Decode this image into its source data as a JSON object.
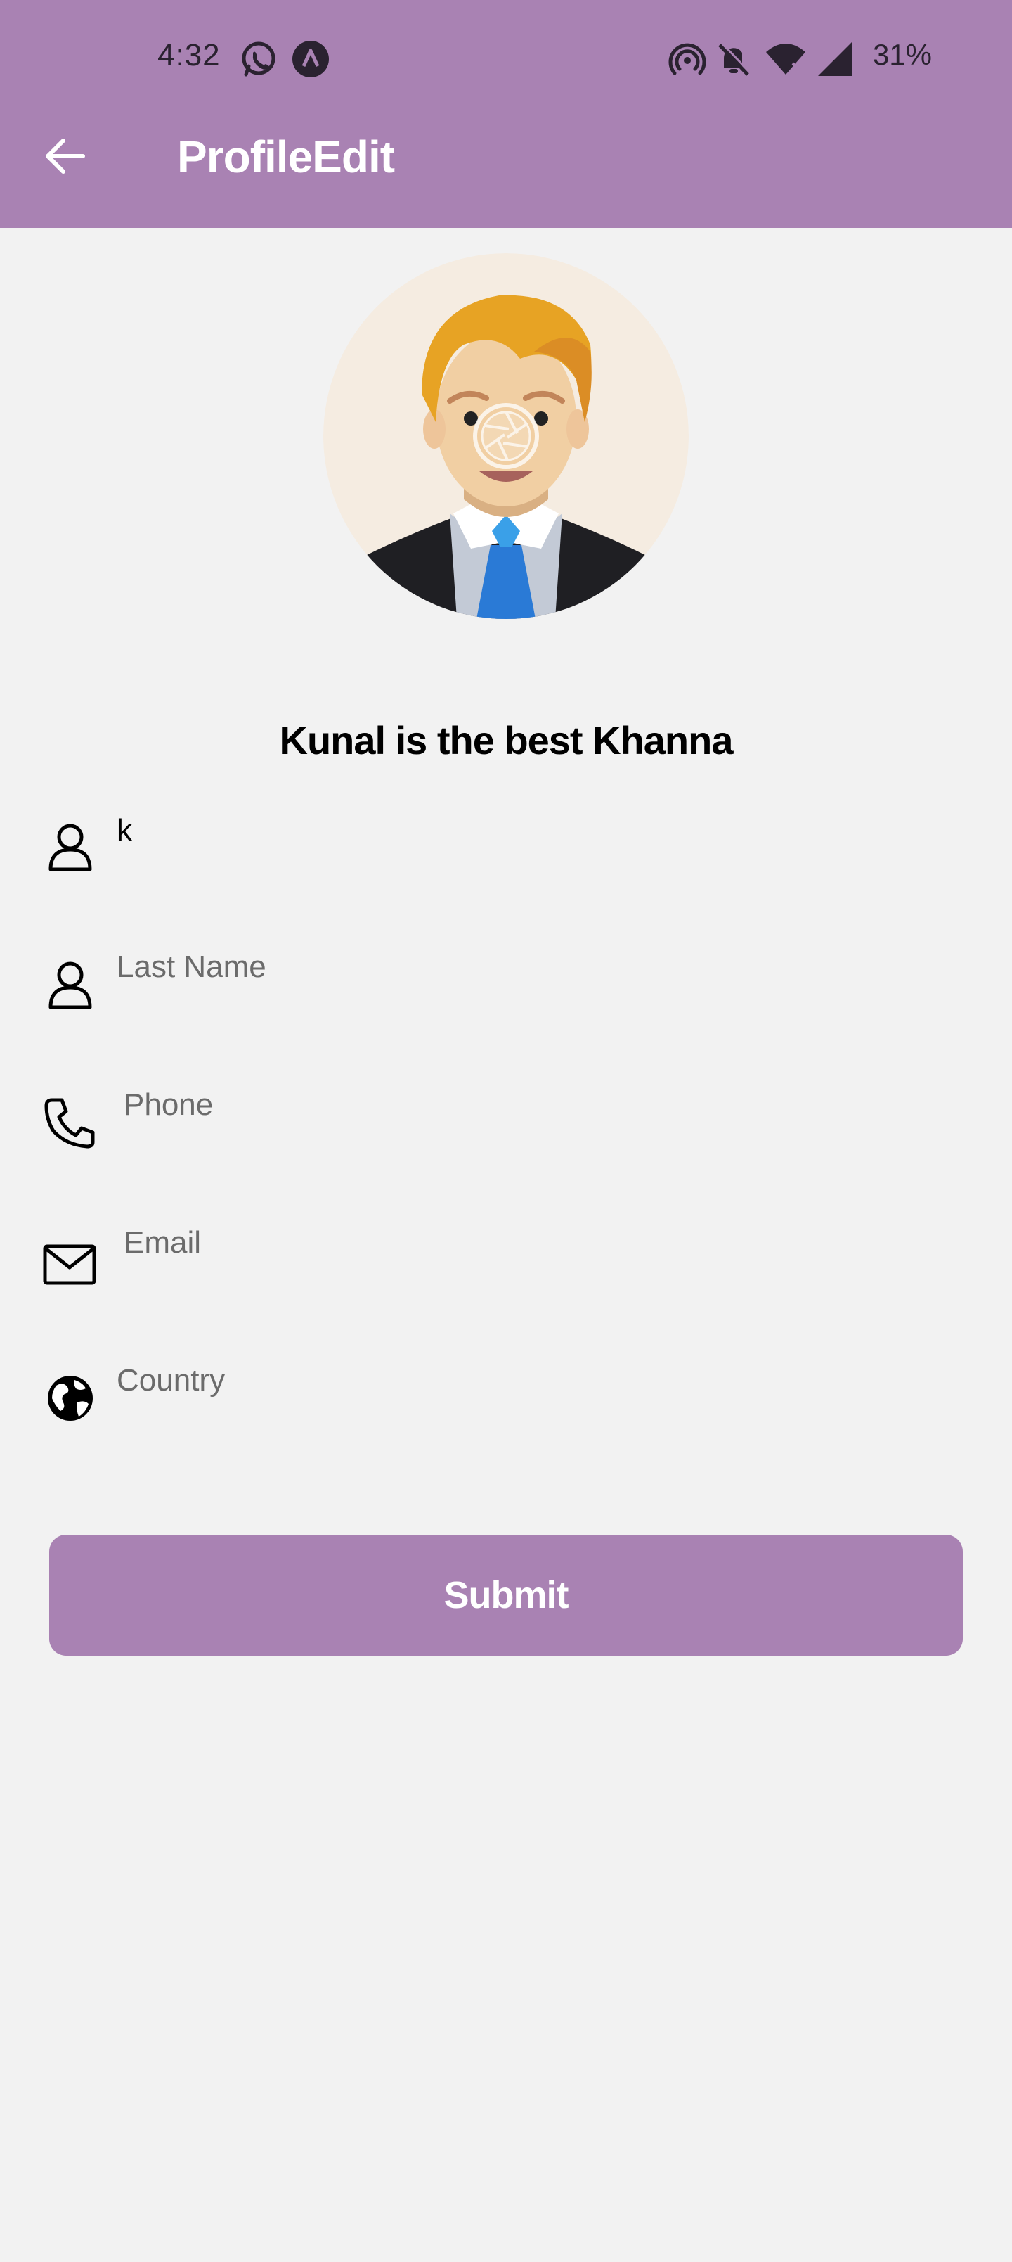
{
  "status_bar": {
    "time": "4:32",
    "battery": "31%",
    "icons": [
      "whatsapp-icon",
      "app-notification-icon",
      "hotspot-icon",
      "notifications-off-icon",
      "wifi-icon",
      "cellular-signal-icon"
    ]
  },
  "toolbar": {
    "title": "ProfileEdit",
    "back_icon": "arrow-left-icon"
  },
  "profile": {
    "name": "Kunal is the best Khanna",
    "avatar_icon": "avatar-illustration",
    "camera_overlay_icon": "camera-aperture-icon"
  },
  "form": {
    "first_name": {
      "value": "k",
      "icon": "person-icon"
    },
    "last_name": {
      "placeholder": "Last Name",
      "icon": "person-icon"
    },
    "phone": {
      "placeholder": "Phone",
      "icon": "phone-icon"
    },
    "email": {
      "placeholder": "Email",
      "icon": "mail-icon"
    },
    "country": {
      "placeholder": "Country",
      "icon": "globe-icon"
    },
    "submit_label": "Submit"
  },
  "colors": {
    "accent": "#a982b3",
    "background": "#f2f2f2"
  }
}
